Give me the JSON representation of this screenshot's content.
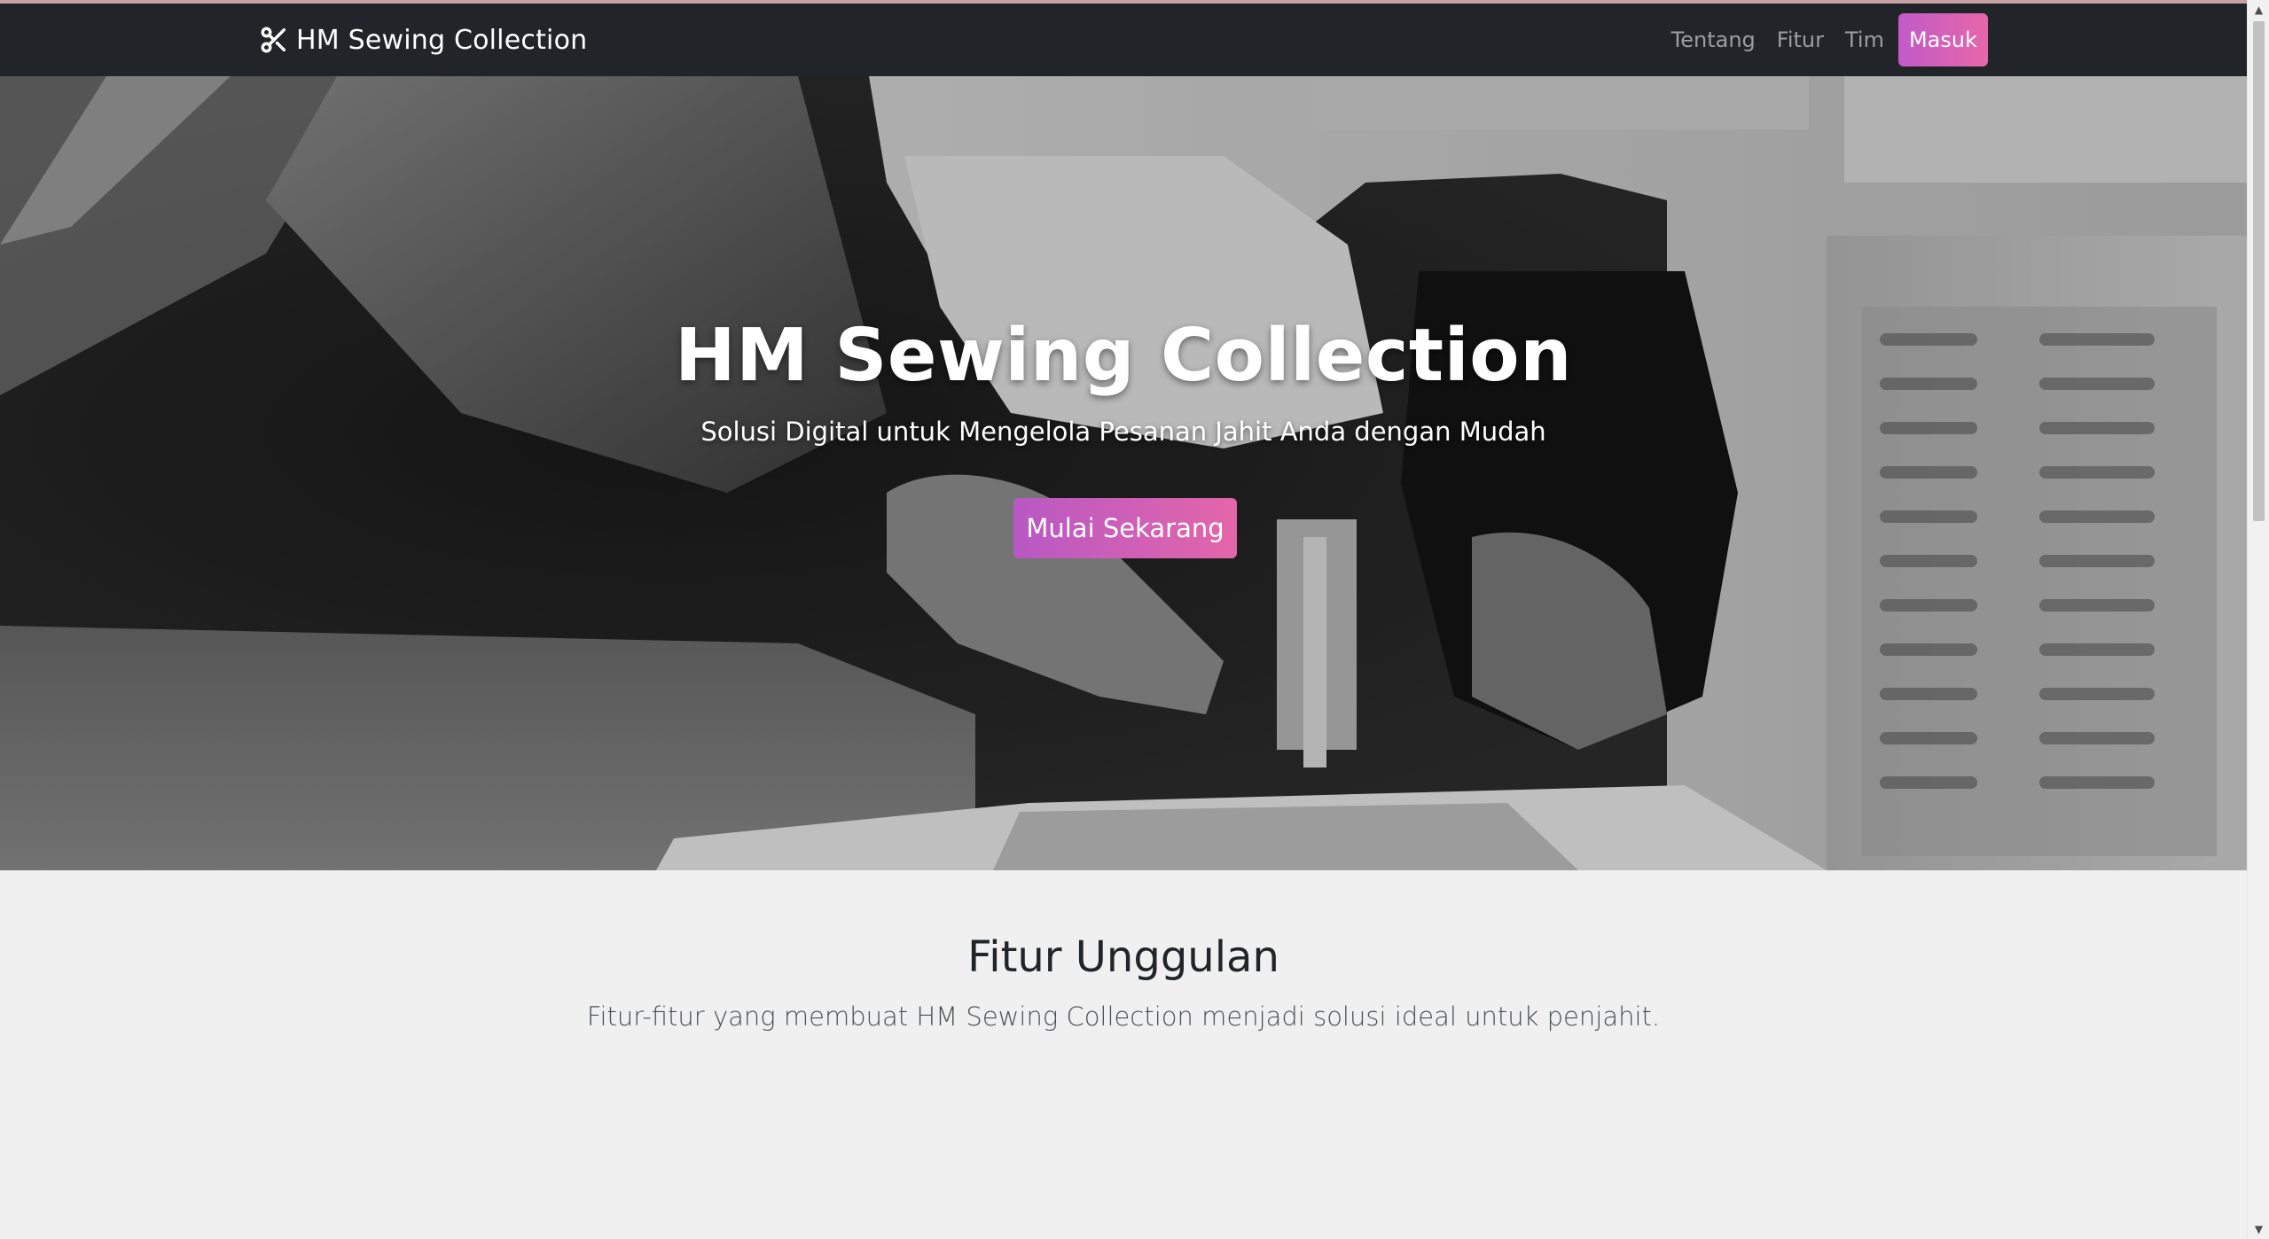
{
  "navbar": {
    "brand": "HM Sewing Collection",
    "brand_icon": "scissors-icon",
    "links": [
      "Tentang",
      "Fitur",
      "Tim"
    ],
    "login_label": "Masuk"
  },
  "hero": {
    "title": "HM Sewing Collection",
    "subtitle": "Solusi Digital untuk Mengelola Pesanan Jahit Anda dengan Mudah",
    "cta_label": "Mulai Sekarang"
  },
  "features": {
    "title": "Fitur Unggulan",
    "subtitle": "Fitur-fitur yang membuat HM Sewing Collection menjadi solusi ideal untuk penjahit."
  },
  "colors": {
    "navbar_bg": "#212529",
    "accent_start": "#c25ac9",
    "accent_end": "#e767a8",
    "page_bg": "#f0f0f0"
  }
}
